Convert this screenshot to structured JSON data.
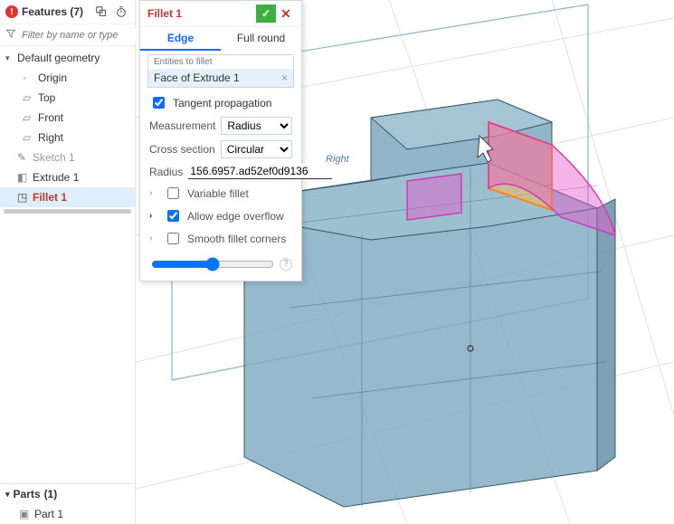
{
  "features": {
    "title": "Features",
    "count": "(7)",
    "filter_placeholder": "Filter by name or type",
    "tree": {
      "default_geometry": "Default geometry",
      "origin": "Origin",
      "top": "Top",
      "front": "Front",
      "right": "Right",
      "sketch1": "Sketch 1",
      "extrude1": "Extrude 1",
      "fillet1": "Fillet 1"
    }
  },
  "parts": {
    "title": "Parts",
    "count": "(1)",
    "part1": "Part 1"
  },
  "dialog": {
    "title": "Fillet 1",
    "tab_edge": "Edge",
    "tab_full": "Full round",
    "entities_label": "Entities to fillet",
    "entity_item": "Face of Extrude 1",
    "tangent_prop": "Tangent propagation",
    "measurement_label": "Measurement",
    "measurement_value": "Radius",
    "cross_section_label": "Cross section",
    "cross_section_value": "Circular",
    "radius_label": "Radius",
    "radius_value": "156.6957.ad52ef0d9136",
    "variable_fillet": "Variable fillet",
    "allow_overflow": "Allow edge overflow",
    "smooth_corners": "Smooth fillet corners"
  },
  "viewport": {
    "label_right": "Right"
  },
  "icons": {
    "configure": "⎘",
    "stopwatch": "◷",
    "funnel": "▽"
  }
}
